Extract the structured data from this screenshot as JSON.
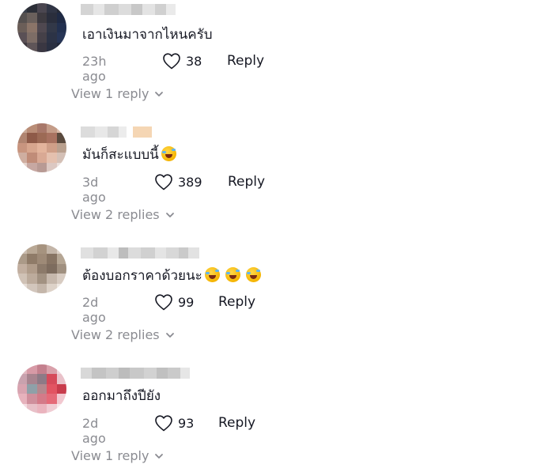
{
  "comments": [
    {
      "text": "เอาเงินมาจากไหนครับ",
      "emoji_count": 0,
      "time": "23h ago",
      "likes": "38",
      "reply_label": "Reply",
      "view_replies": "View 1 reply"
    },
    {
      "text": "มันก็สะแบบนี้",
      "emoji_count": 1,
      "time": "3d ago",
      "likes": "389",
      "reply_label": "Reply",
      "view_replies": "View 2 replies"
    },
    {
      "text": "ต้องบอกราคาด้วยนะ",
      "emoji_count": 3,
      "time": "2d ago",
      "likes": "99",
      "reply_label": "Reply",
      "view_replies": "View 2 replies"
    },
    {
      "text": "ออกมาถึงปียัง",
      "emoji_count": 0,
      "time": "2d ago",
      "likes": "93",
      "reply_label": "Reply",
      "view_replies": "View 1 reply"
    }
  ],
  "icons": {
    "like": "heart-outline-icon",
    "expand": "chevron-down-icon",
    "emoji": "rolling-on-floor-laughing-emoji"
  },
  "colors": {
    "text": "#161823",
    "muted": "#8a8b91"
  }
}
